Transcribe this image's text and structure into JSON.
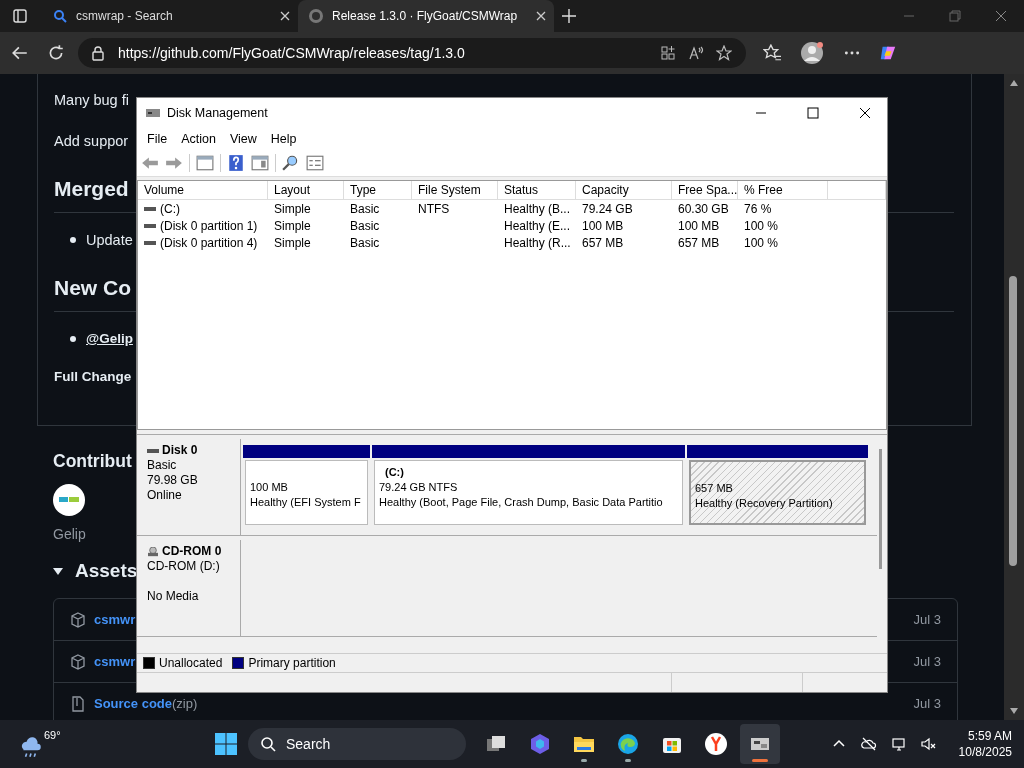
{
  "browser": {
    "tabs": [
      {
        "title": "csmwrap - Search",
        "kind": "search",
        "selected": false
      },
      {
        "title": "Release 1.3.0 · FlyGoat/CSMWrap",
        "kind": "github",
        "selected": true
      }
    ],
    "url": "https://github.com/FlyGoat/CSMWrap/releases/tag/1.3.0"
  },
  "page": {
    "blocks": [
      {
        "kind": "para",
        "text": "Many bug fi"
      },
      {
        "kind": "para",
        "text": "Add suppor"
      },
      {
        "kind": "heading",
        "text": "Merged"
      },
      {
        "kind": "bullet",
        "text": "Update"
      },
      {
        "kind": "heading",
        "text": "New Co"
      },
      {
        "kind": "link-bullet",
        "text": "@Gelip"
      },
      {
        "kind": "bold",
        "text": "Full Change"
      }
    ],
    "contributors_heading": "Contribut",
    "contributor": "Gelip",
    "assets_heading": "Assets",
    "assets": [
      {
        "kind": "package",
        "name": "csmwr",
        "date": "Jul 3"
      },
      {
        "kind": "package",
        "name": "csmwr",
        "date": "Jul 3"
      },
      {
        "kind": "zip",
        "name": "Source code",
        "suffix": "(zip)",
        "date": "Jul 3"
      }
    ]
  },
  "dialog": {
    "title": "Disk Management",
    "menu": [
      "File",
      "Action",
      "View",
      "Help"
    ],
    "columns": [
      "Volume",
      "Layout",
      "Type",
      "File System",
      "Status",
      "Capacity",
      "Free Spa...",
      "% Free"
    ],
    "rows": [
      [
        "(C:)",
        "Simple",
        "Basic",
        "NTFS",
        "Healthy (B...",
        "79.24 GB",
        "60.30 GB",
        "76 %"
      ],
      [
        "(Disk 0 partition 1)",
        "Simple",
        "Basic",
        "",
        "Healthy (E...",
        "100 MB",
        "100 MB",
        "100 %"
      ],
      [
        "(Disk 0 partition 4)",
        "Simple",
        "Basic",
        "",
        "Healthy (R...",
        "657 MB",
        "657 MB",
        "100 %"
      ]
    ],
    "disks": [
      {
        "kind": "disk",
        "name": "Disk 0",
        "lines": [
          "Basic",
          "79.98 GB",
          "Online"
        ],
        "partitions": [
          {
            "size": "100 MB",
            "status": "Healthy (EFI System F",
            "selected": false
          },
          {
            "label": "(C:)",
            "size": "79.24 GB NTFS",
            "status": "Healthy (Boot, Page File, Crash Dump, Basic Data Partitio",
            "selected": false
          },
          {
            "size": "657 MB",
            "status": "Healthy (Recovery Partition)",
            "selected": true
          }
        ]
      },
      {
        "kind": "cdrom",
        "name": "CD-ROM 0",
        "lines": [
          "CD-ROM (D:)",
          "No Media"
        ]
      }
    ],
    "legend": [
      {
        "label": "Unallocated",
        "color": "#000000"
      },
      {
        "label": "Primary partition",
        "color": "#000080"
      }
    ]
  },
  "taskbar": {
    "weather": "69°",
    "search": "Search",
    "apps": [
      {
        "kind": "taskview",
        "running": false,
        "active": false
      },
      {
        "kind": "copilot",
        "running": false,
        "active": false
      },
      {
        "kind": "folder",
        "running": true,
        "active": false
      },
      {
        "kind": "edge",
        "running": true,
        "active": false
      },
      {
        "kind": "store",
        "running": false,
        "active": false
      },
      {
        "kind": "yandex",
        "running": false,
        "active": false
      },
      {
        "kind": "diskmgmt",
        "running": true,
        "active": true
      }
    ],
    "time": "5:59 AM",
    "date": "10/8/2025"
  }
}
